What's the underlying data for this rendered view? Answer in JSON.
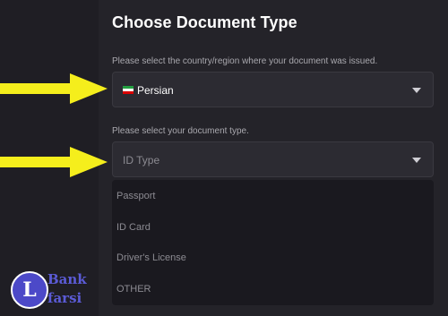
{
  "page": {
    "title": "Choose Document Type"
  },
  "country": {
    "label": "Please select the country/region where your document was issued.",
    "value": "Persian",
    "flag_colors": [
      "#239f40",
      "#ffffff",
      "#da0000"
    ]
  },
  "document": {
    "label": "Please select your document type.",
    "placeholder": "ID Type",
    "options": [
      "Passport",
      "ID Card",
      "Driver's License",
      "OTHER"
    ]
  },
  "watermark": {
    "letter": "L",
    "line1": "Bank",
    "line2": "farsi"
  },
  "colors": {
    "arrow": "#f5ee1c",
    "accent": "#4c49c8"
  }
}
